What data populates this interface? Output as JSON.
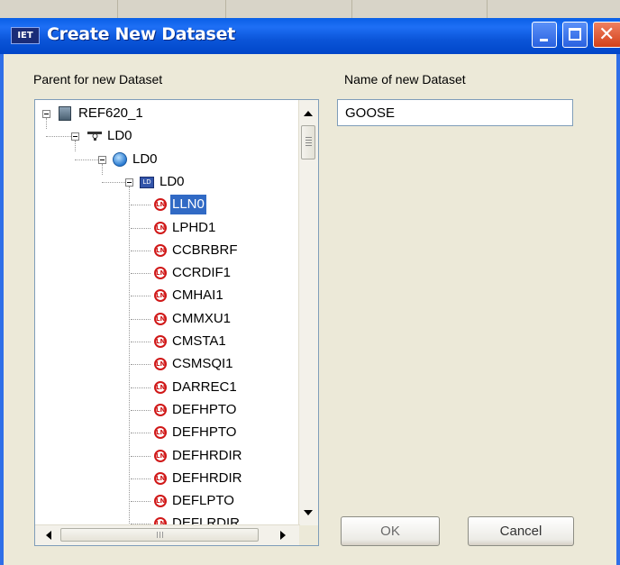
{
  "window": {
    "title": "Create New Dataset",
    "app_icon_text": "IET",
    "buttons": [
      "minimize",
      "maximize",
      "close"
    ]
  },
  "labels": {
    "parent": "Parent for new Dataset",
    "name": "Name of new Dataset"
  },
  "name_input": {
    "value": "GOOSE"
  },
  "tree": {
    "root": "REF620_1",
    "ld_plug": "LD0",
    "ld_globe": "LD0",
    "ld_box": "LD0",
    "nodes": [
      "LLN0",
      "LPHD1",
      "CCBRBRF",
      "CCRDIF1",
      "CMHAI1",
      "CMMXU1",
      "CMSTA1",
      "CSMSQI1",
      "DARREC1",
      "DEFHPTO",
      "DEFHPTO",
      "DEFHRDIR",
      "DEFHRDIR",
      "DEFLPTO",
      "DEFLRDIR"
    ],
    "selected": "LLN0",
    "ln_icon_text": "LN",
    "ld_icon_text": "LD"
  },
  "buttons": {
    "ok": "OK",
    "cancel": "Cancel"
  },
  "colors": {
    "title_bar": "#0b55d9",
    "selection": "#316ac5",
    "dialog_bg": "#ece9d8"
  }
}
